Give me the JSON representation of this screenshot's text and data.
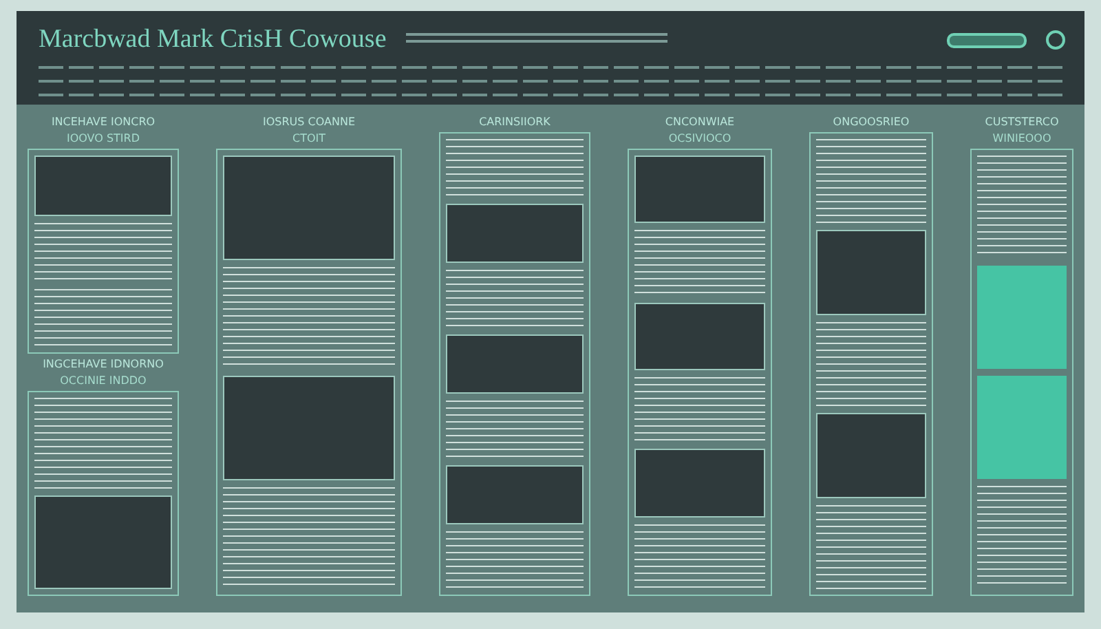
{
  "header": {
    "title": "Marcbwad Mark CrisH Cowouse"
  },
  "columns": [
    {
      "heading": "INCEHAVE IONCRO",
      "subheading": "IOOVO STIRD",
      "blocks": [
        {
          "kind": "dark"
        },
        {
          "kind": "lines"
        },
        {
          "kind": "lines"
        }
      ],
      "footer_heading": "INGCEHAVE IDNORNO",
      "footer_subheading": "OCCINIE INDDO",
      "footer_blocks": [
        {
          "kind": "lines"
        },
        {
          "kind": "dark"
        }
      ]
    },
    {
      "heading": "IOSRUS COANNE",
      "subheading": "CTOIT",
      "blocks": [
        {
          "kind": "dark"
        },
        {
          "kind": "lines"
        },
        {
          "kind": "dark"
        },
        {
          "kind": "lines"
        }
      ]
    },
    {
      "heading": "CARINSIIORK",
      "blocks": [
        {
          "kind": "lines"
        },
        {
          "kind": "dark"
        },
        {
          "kind": "lines"
        },
        {
          "kind": "dark"
        },
        {
          "kind": "lines"
        },
        {
          "kind": "dark"
        },
        {
          "kind": "lines"
        }
      ]
    },
    {
      "heading": "CNCONWIAE",
      "subheading": "OCSIVIOCO",
      "blocks": [
        {
          "kind": "dark"
        },
        {
          "kind": "lines"
        },
        {
          "kind": "dark"
        },
        {
          "kind": "lines"
        },
        {
          "kind": "dark"
        },
        {
          "kind": "lines"
        }
      ]
    },
    {
      "heading": "ONGOOSRIEO",
      "blocks": [
        {
          "kind": "lines"
        },
        {
          "kind": "dark"
        },
        {
          "kind": "lines"
        },
        {
          "kind": "dark"
        },
        {
          "kind": "lines"
        }
      ]
    },
    {
      "heading": "CUSTSTERCO",
      "subheading": "WINIEOOO",
      "blocks": [
        {
          "kind": "lines"
        },
        {
          "kind": "accent"
        },
        {
          "kind": "accent"
        },
        {
          "kind": "lines"
        }
      ]
    }
  ]
}
